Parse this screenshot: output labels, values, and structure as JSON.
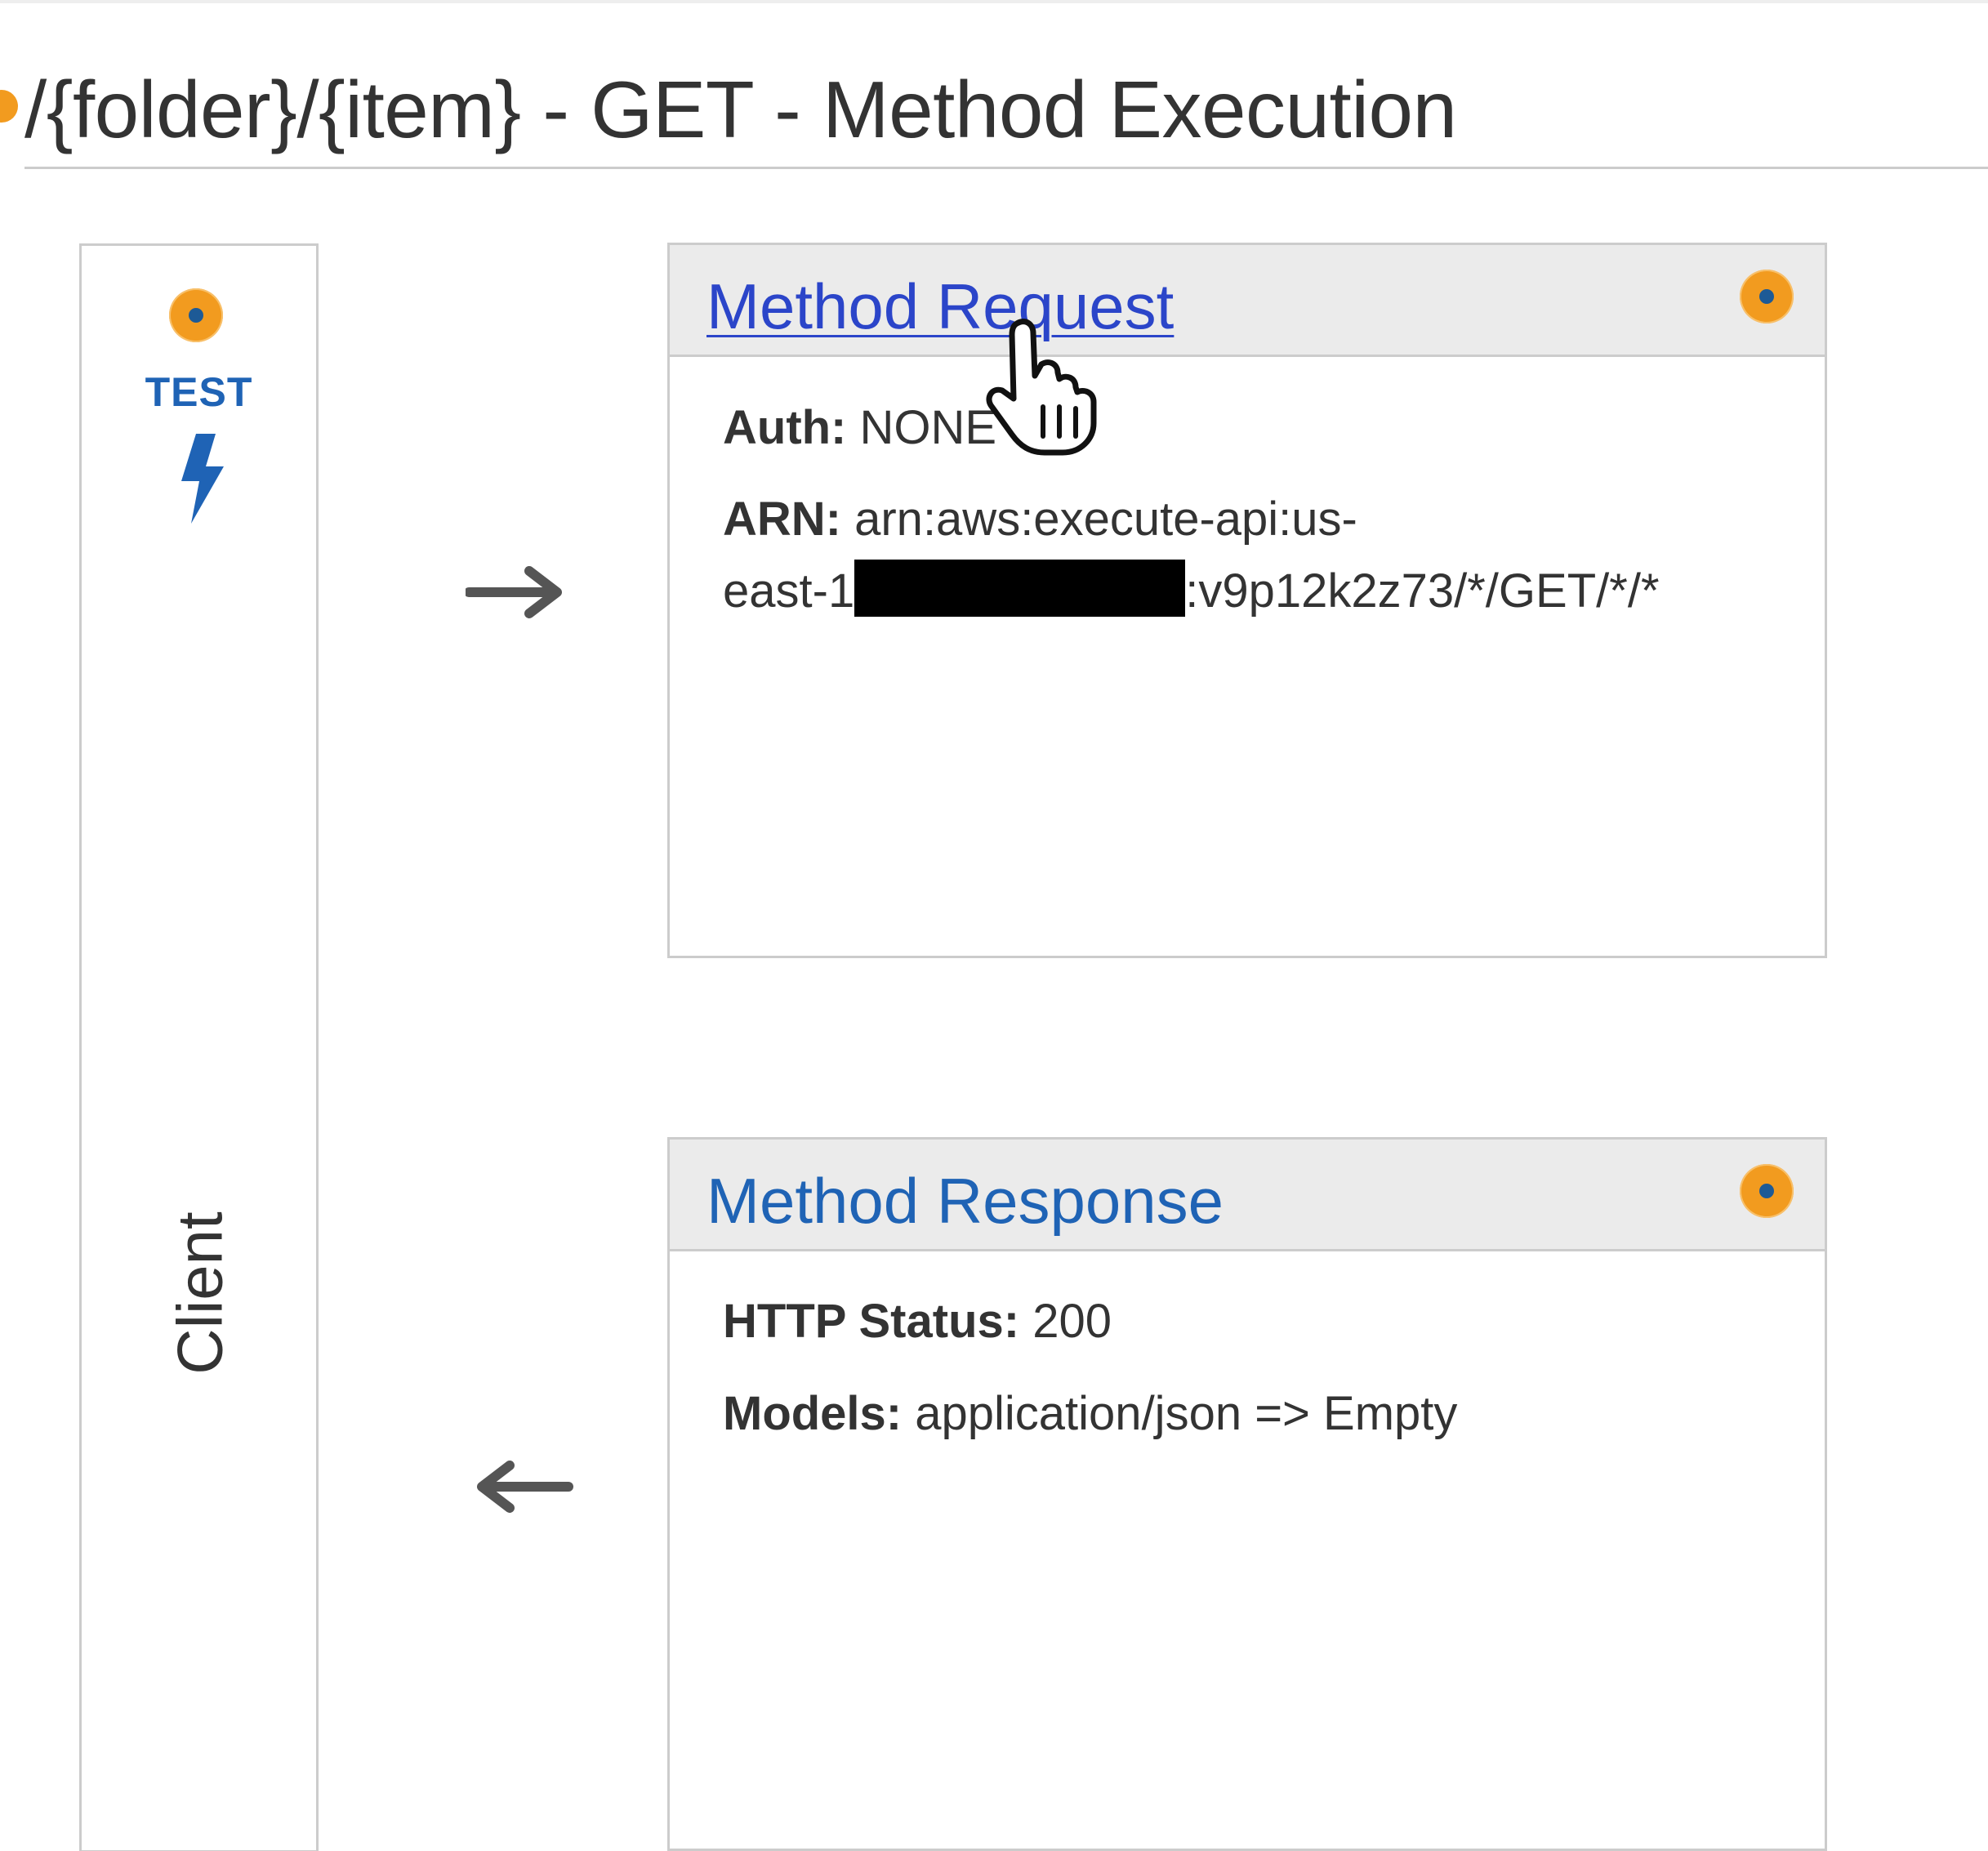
{
  "page": {
    "title": "/{folder}/{item} - GET - Method Execution"
  },
  "client": {
    "test_label": "TEST",
    "label": "Client",
    "dot_icon": "settings-dot-icon",
    "test_icon": "lightning-bolt-icon"
  },
  "method_request": {
    "title": "Method Request",
    "auth_key": "Auth:",
    "auth_value": "NONE",
    "arn_key": "ARN:",
    "arn_line1": "arn:aws:execute-api:us-",
    "arn_line2_prefix": "east-1",
    "arn_line2_suffix": ":v9p12k2z73/*/GET/*/*"
  },
  "method_response": {
    "title": "Method Response",
    "status_key": "HTTP Status:",
    "status_value": "200",
    "models_key": "Models:",
    "models_value": "application/json => Empty"
  },
  "colors": {
    "accent_orange": "#f29b1f",
    "link_blue": "#1f63b5",
    "hover_link": "#2b45c9",
    "panel_header_bg": "#ebebeb",
    "border": "#cccccc"
  }
}
